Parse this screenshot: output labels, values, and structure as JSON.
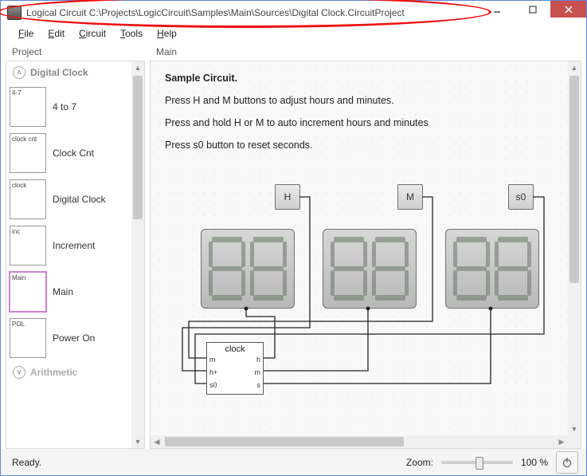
{
  "window": {
    "title": "Logical Circuit C:\\Projects\\LogicCircuit\\Samples\\Main\\Sources\\Digital Clock.CircuitProject"
  },
  "menu": {
    "file": "File",
    "edit": "Edit",
    "circuit": "Circuit",
    "tools": "Tools",
    "help": "Help"
  },
  "panes": {
    "project": "Project",
    "main": "Main"
  },
  "accordion": {
    "section1": "Digital Clock",
    "section2": "Arithmetic"
  },
  "tree": {
    "items": [
      {
        "thumb": "4-7",
        "label": "4 to 7"
      },
      {
        "thumb": "clock cnt",
        "label": "Clock Cnt"
      },
      {
        "thumb": "clock",
        "label": "Digital Clock"
      },
      {
        "thumb": "inc",
        "label": "Increment"
      },
      {
        "thumb": "Main",
        "label": "Main"
      },
      {
        "thumb": "POL",
        "label": "Power On"
      }
    ]
  },
  "description": {
    "title": "Sample Circuit.",
    "line1": "Press H and M buttons to adjust hours and minutes.",
    "line2": "Press and hold H or M to auto increment hours and minutes",
    "line3": "Press s0 button to reset seconds."
  },
  "buttons": {
    "h": "H",
    "m": "M",
    "s0": "s0"
  },
  "clockbox": {
    "title": "clock",
    "ports": {
      "m_in": "m",
      "h_in": "h+",
      "s0_in": "s0",
      "h_out": "h",
      "m_out": "m",
      "s_out": "s"
    }
  },
  "status": {
    "text": "Ready.",
    "zoom_label": "Zoom:",
    "zoom_value": "100 %"
  },
  "colors": {
    "close": "#c8504f",
    "annotation": "#e11"
  }
}
